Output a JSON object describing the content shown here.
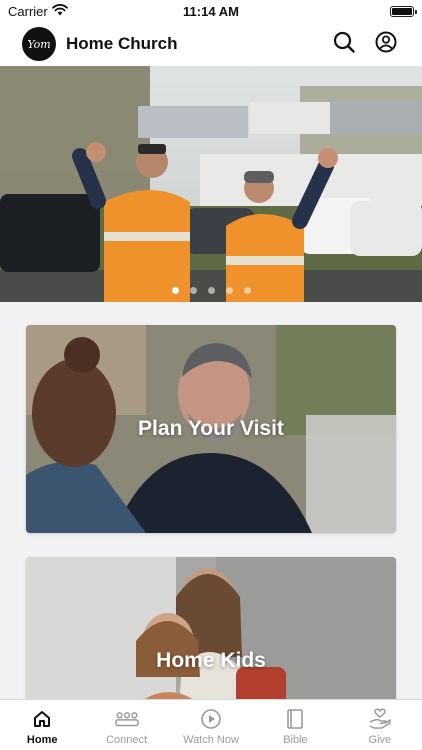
{
  "status_bar": {
    "carrier": "Carrier",
    "time": "11:14 AM",
    "battery_level": 1.0
  },
  "header": {
    "title": "Home Church",
    "logo_text": "Yom",
    "search_icon": "search-icon",
    "profile_icon": "profile-icon"
  },
  "hero": {
    "slide_count": 5,
    "active_slide": 1
  },
  "cards": [
    {
      "label": "Plan Your Visit"
    },
    {
      "label": "Home Kids"
    }
  ],
  "tabs": [
    {
      "label": "Home",
      "icon": "home-icon",
      "active": true
    },
    {
      "label": "Connect",
      "icon": "people-icon",
      "active": false
    },
    {
      "label": "Watch Now",
      "icon": "play-icon",
      "active": false
    },
    {
      "label": "Bible",
      "icon": "book-icon",
      "active": false
    },
    {
      "label": "Give",
      "icon": "give-icon",
      "active": false
    }
  ]
}
